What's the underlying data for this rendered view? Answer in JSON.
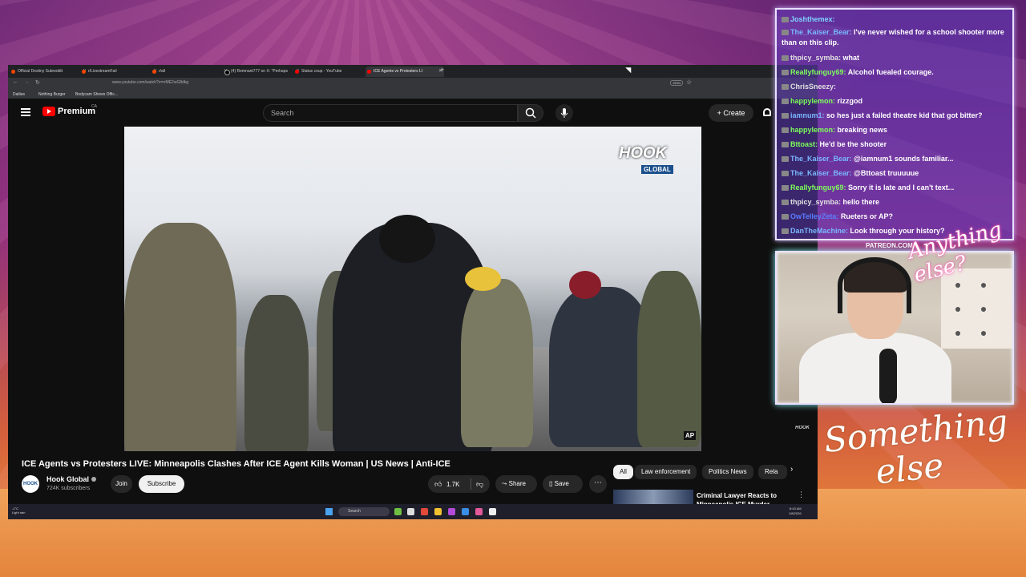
{
  "colors": {
    "accent": "#ff0000",
    "chat_bg": "#603cbe",
    "chat_border": "#e8e0ff"
  },
  "browser": {
    "tabs": [
      {
        "label": "Official Destiny Subreddit"
      },
      {
        "label": "r/LivestreamFail"
      },
      {
        "label": "r/all"
      },
      {
        "label": "(4) Remnant777 on X: \"Perhaps"
      },
      {
        "label": "Status coup - YouTube"
      },
      {
        "label": "ICE Agents vs Protesters LI"
      }
    ],
    "url": "www.youtube.com/watch?v=rrME2wG8dkg",
    "zoom": "150%",
    "bookmarks": [
      "Dailies",
      "Nothing Burger",
      "Bodycam Shows Offic..."
    ]
  },
  "youtube": {
    "brand": "Premium",
    "country": "CA",
    "search_placeholder": "Search",
    "create_label": "Create",
    "video": {
      "title": "ICE Agents vs Protesters LIVE: Minneapolis Clashes After ICE Agent Kills Woman | US News | Anti-ICE",
      "overlay_logo": "HOOK",
      "overlay_logo_sub": "GLOBAL",
      "ap_badge": "AP"
    },
    "channel": {
      "name": "Hook Global",
      "subscribers": "724K subscribers",
      "avatar_text": "HOOK"
    },
    "buttons": {
      "join": "Join",
      "subscribe": "Subscribe",
      "likes": "1.7K",
      "share": "Share",
      "save": "Save"
    },
    "chips": [
      "All",
      "Law enforcement",
      "Politics News",
      "Rela"
    ],
    "recommended": {
      "title": "Criminal Lawyer Reacts to Minneapolis ICE Murder"
    }
  },
  "taskbar": {
    "weather_temp": "-1°C",
    "weather_desc": "Light rain",
    "search_label": "Search",
    "time": "8:43 AM",
    "date": "1/8/2026"
  },
  "chat": {
    "messages": [
      {
        "user": "Joshthemex",
        "color": "#7fd4ff",
        "text": ""
      },
      {
        "user": "The_Kaiser_Bear",
        "color": "#7ab8ff",
        "text": "I've never wished for a school shooter more than on this clip."
      },
      {
        "user": "thpicy_symba",
        "color": "#e0e0e0",
        "text": "what"
      },
      {
        "user": "Reallyfunguy69",
        "color": "#7dff5a",
        "text": "Alcohol fuealed courage."
      },
      {
        "user": "ChrisSneezy",
        "color": "#e0e0e0",
        "text": ""
      },
      {
        "user": "happylemon",
        "color": "#7dff5a",
        "text": "rizzgod"
      },
      {
        "user": "iamnum1",
        "color": "#7ab8ff",
        "text": "so hes just a failed theatre kid that got bitter?"
      },
      {
        "user": "happylemon",
        "color": "#7dff5a",
        "text": "breaking news"
      },
      {
        "user": "Bttoast",
        "color": "#7dff5a",
        "text": "He'd be the shooter"
      },
      {
        "user": "The_Kaiser_Bear",
        "color": "#7ab8ff",
        "text": "@iamnum1 sounds familiar..."
      },
      {
        "user": "The_Kaiser_Bear",
        "color": "#7ab8ff",
        "text": "@Bttoast truuuuue"
      },
      {
        "user": "Reallyfunguy69",
        "color": "#7dff5a",
        "text": "Sorry it is late and I can't text..."
      },
      {
        "user": "thpicy_symba",
        "color": "#e0e0e0",
        "text": "hello there"
      },
      {
        "user": "OwTelleyZeta",
        "color": "#5a7dff",
        "text": "Rueters or AP?"
      },
      {
        "user": "DanTheMachine",
        "color": "#7ab8ff",
        "text": "Look through your history?"
      }
    ]
  },
  "overlay": {
    "patreon": "PATREON.COM/",
    "anything": "Anything else?",
    "something_l1": "Something",
    "something_l2": "else"
  }
}
